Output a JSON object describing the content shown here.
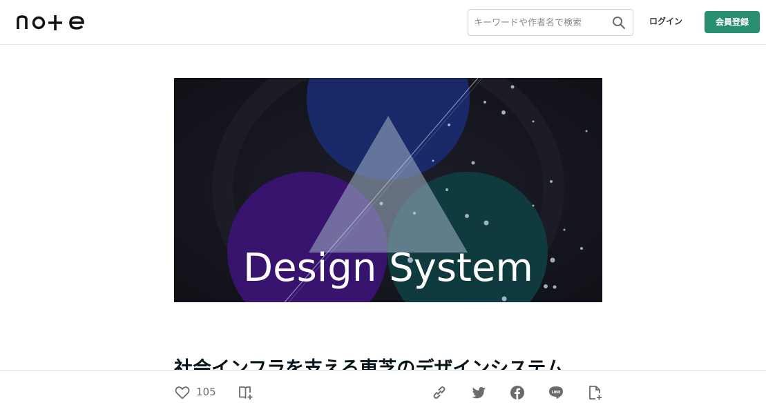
{
  "header": {
    "logo_text": "note",
    "search_placeholder": "キーワードや作者名で検索",
    "search_icon": "search-icon",
    "login_label": "ログイン",
    "signup_label": "会員登録",
    "brand_color": "#2a8f70"
  },
  "article": {
    "eyecatch_text": "Design System",
    "title": "社会インフラを支える東芝のデザインシステム"
  },
  "actions": {
    "like_icon": "heart-icon",
    "like_count": "105",
    "magazine_icon": "magazine-add-icon",
    "share_icons": [
      "link-icon",
      "twitter-icon",
      "facebook-icon",
      "line-icon",
      "embed-icon"
    ]
  }
}
